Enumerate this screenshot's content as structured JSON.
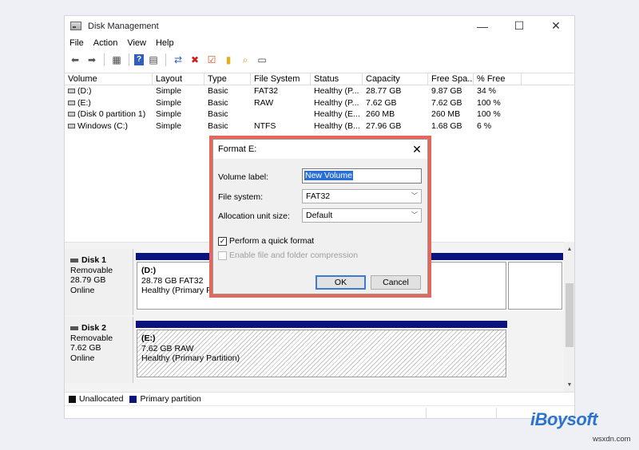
{
  "window": {
    "title": "Disk Management",
    "minimize": "—",
    "maximize": "☐",
    "close": "✕"
  },
  "menu": [
    "File",
    "Action",
    "View",
    "Help"
  ],
  "toolbar": [
    {
      "icon": "back-arrow-icon",
      "glyph": "⬅"
    },
    {
      "icon": "forward-arrow-icon",
      "glyph": "➡"
    },
    {
      "icon": "properties-icon",
      "glyph": "▦"
    },
    {
      "icon": "help-icon",
      "glyph": "?"
    },
    {
      "icon": "console-icon",
      "glyph": "▤"
    },
    {
      "icon": "connect-icon",
      "glyph": "⇄"
    },
    {
      "icon": "delete-icon",
      "glyph": "✖"
    },
    {
      "icon": "check-icon",
      "glyph": "☑"
    },
    {
      "icon": "folder-icon",
      "glyph": "▮"
    },
    {
      "icon": "search-icon",
      "glyph": "⌕"
    },
    {
      "icon": "view-icon",
      "glyph": "▭"
    }
  ],
  "volume_table": {
    "headers": [
      "Volume",
      "Layout",
      "Type",
      "File System",
      "Status",
      "Capacity",
      "Free Spa...",
      "% Free"
    ],
    "rows": [
      [
        "(D:)",
        "Simple",
        "Basic",
        "FAT32",
        "Healthy (P...",
        "28.77 GB",
        "9.87 GB",
        "34 %"
      ],
      [
        "(E:)",
        "Simple",
        "Basic",
        "RAW",
        "Healthy (P...",
        "7.62 GB",
        "7.62 GB",
        "100 %"
      ],
      [
        "(Disk 0 partition 1)",
        "Simple",
        "Basic",
        "",
        "Healthy (E...",
        "260 MB",
        "260 MB",
        "100 %"
      ],
      [
        "Windows (C:)",
        "Simple",
        "Basic",
        "NTFS",
        "Healthy (B...",
        "27.96 GB",
        "1.68 GB",
        "6 %"
      ]
    ]
  },
  "disks": [
    {
      "name": "Disk 1",
      "type": "Removable",
      "size": "28.79 GB",
      "status": "Online",
      "partition": {
        "name": "(D:)",
        "detail": "28.78 GB FAT32",
        "status": "Healthy (Primary Pa"
      }
    },
    {
      "name": "Disk 2",
      "type": "Removable",
      "size": "7.62 GB",
      "status": "Online",
      "partition": {
        "name": "(E:)",
        "detail": "7.62 GB RAW",
        "status": "Healthy (Primary Partition)"
      }
    }
  ],
  "legend": [
    {
      "label": "Unallocated",
      "color": "#111111"
    },
    {
      "label": "Primary partition",
      "color": "#0b147e"
    }
  ],
  "dialog": {
    "title": "Format E:",
    "close": "✕",
    "volume_label_text": "Volume label:",
    "volume_label_value": "New Volume",
    "file_system_text": "File system:",
    "file_system_value": "FAT32",
    "allocation_text": "Allocation unit size:",
    "allocation_value": "Default",
    "quick_format_text": "Perform a quick format",
    "quick_format_checked": true,
    "compression_text": "Enable file and folder compression",
    "compression_enabled": false,
    "ok_label": "OK",
    "cancel_label": "Cancel"
  },
  "watermark": {
    "logo": "iBoysoft",
    "site": "wsxdn.com"
  },
  "colors": {
    "partition_bar": "#0b147e",
    "highlight_frame": "#e4665c",
    "logo_blue": "#2a73d0"
  }
}
